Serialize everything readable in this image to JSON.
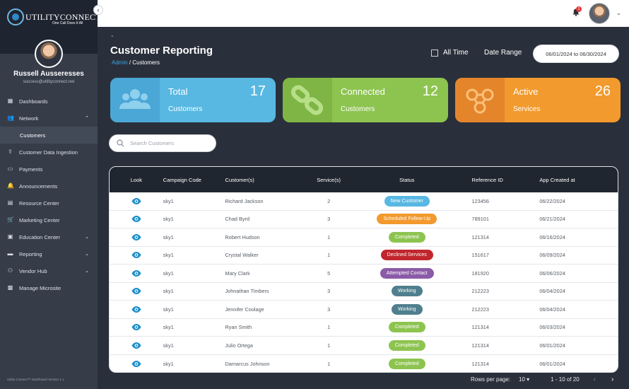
{
  "brand": {
    "name": "UTILITYCONNECT",
    "tagline": "One Call Does It All"
  },
  "user": {
    "name": "Russell Ausseresses",
    "email": "success@utilityconnect.net"
  },
  "sidebar": {
    "items": [
      {
        "label": "Dashboards",
        "icon": "dashboard-icon"
      },
      {
        "label": "Network",
        "icon": "people-icon",
        "caret": "⌃"
      },
      {
        "label": "Customers",
        "sub": true
      },
      {
        "label": "Customer Data Ingestion",
        "icon": "ingest-icon"
      },
      {
        "label": "Payments",
        "icon": "card-icon"
      },
      {
        "label": "Announcements",
        "icon": "bell-icon"
      },
      {
        "label": "Resource Center",
        "icon": "resource-icon"
      },
      {
        "label": "Marketing Center",
        "icon": "cart-icon"
      },
      {
        "label": "Education Center",
        "icon": "calendar-icon",
        "caret": "⌄"
      },
      {
        "label": "Reporting",
        "icon": "report-icon",
        "caret": "⌄"
      },
      {
        "label": "Vendor Hub",
        "icon": "vendor-icon",
        "caret": "⌄"
      },
      {
        "label": "Manage Microsite",
        "icon": "site-icon"
      }
    ],
    "footer": "Utility Connect™ Dashboard Version 1.1"
  },
  "topbar": {
    "notification_count": "1"
  },
  "header": {
    "title": "Customer Reporting",
    "breadcrumb_link": "Admin",
    "breadcrumb_current": "/ Customers",
    "all_time_label": "All Time",
    "date_range_label": "Date Range",
    "date_range_value": "06/01/2024 to 06/30/2024"
  },
  "cards": {
    "total": {
      "title": "Total",
      "sub": "Customers",
      "value": "17",
      "color": "#58b8e2"
    },
    "connected": {
      "title": "Connected",
      "sub": "Customers",
      "value": "12",
      "color": "#8dc450"
    },
    "active": {
      "title": "Active",
      "sub": "Services",
      "value": "26",
      "color": "#f29a2e"
    }
  },
  "search": {
    "placeholder": "Search Customers",
    "value": ""
  },
  "table": {
    "columns": [
      "Look",
      "Campaign Code",
      "Customer(s)",
      "Service(s)",
      "Status",
      "Reference ID",
      "App Created at"
    ],
    "rows": [
      {
        "code": "sky1",
        "customer": "Richard Jackson",
        "services": "2",
        "status": "New Customer",
        "status_color": "#58b8e2",
        "ref": "123456",
        "date": "06/22/2024"
      },
      {
        "code": "sky1",
        "customer": "Chad Byrd",
        "services": "3",
        "status": "Scheduled Follow-Up",
        "status_color": "#f29a2e",
        "ref": "789101",
        "date": "06/21/2024"
      },
      {
        "code": "sky1",
        "customer": "Robert Hudson",
        "services": "1",
        "status": "Completed",
        "status_color": "#8dc450",
        "ref": "121314",
        "date": "06/16/2024"
      },
      {
        "code": "sky1",
        "customer": "Crystal Walker",
        "services": "1",
        "status": "Declined Services",
        "status_color": "#c0262c",
        "ref": "151617",
        "date": "06/09/2024"
      },
      {
        "code": "sky1",
        "customer": "Mary Clark",
        "services": "5",
        "status": "Attempted Contact",
        "status_color": "#8b5ba8",
        "ref": "181920",
        "date": "06/06/2024"
      },
      {
        "code": "sky1",
        "customer": "Johnathan Timbers",
        "services": "3",
        "status": "Working",
        "status_color": "#4f7f8e",
        "ref": "212223",
        "date": "06/04/2024"
      },
      {
        "code": "sky1",
        "customer": "Jennifer Coolage",
        "services": "3",
        "status": "Working",
        "status_color": "#4f7f8e",
        "ref": "212223",
        "date": "06/04/2024"
      },
      {
        "code": "sky1",
        "customer": "Ryan Smith",
        "services": "1",
        "status": "Completed",
        "status_color": "#8dc450",
        "ref": "121314",
        "date": "06/03/2024"
      },
      {
        "code": "sky1",
        "customer": "Julio Ortega",
        "services": "1",
        "status": "Completed",
        "status_color": "#8dc450",
        "ref": "121314",
        "date": "06/01/2024"
      },
      {
        "code": "sky1",
        "customer": "Damarcus Johnson",
        "services": "1",
        "status": "Completed",
        "status_color": "#8dc450",
        "ref": "121314",
        "date": "06/01/2024"
      }
    ]
  },
  "pager": {
    "rows_per_page_label": "Rows per page:",
    "rows_per_page_value": "10",
    "range": "1 - 10 of 20"
  }
}
